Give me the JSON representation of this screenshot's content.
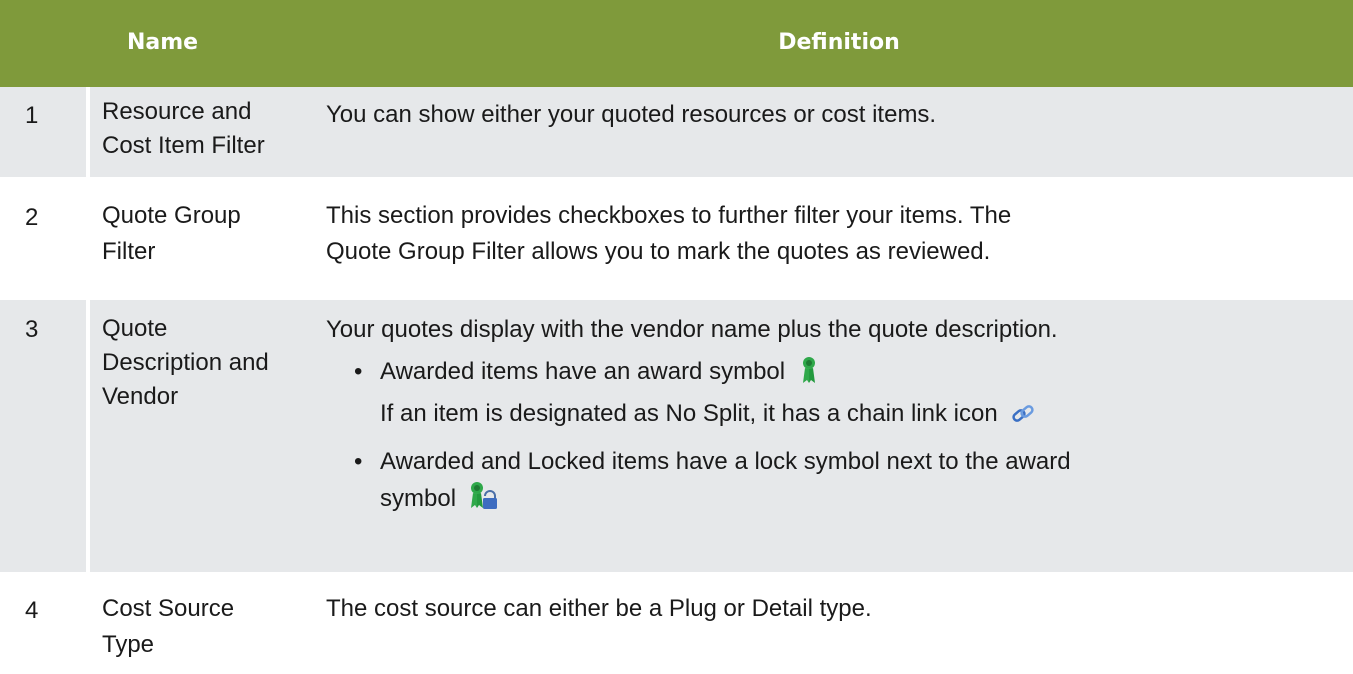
{
  "header": {
    "name": "Name",
    "definition": "Definition"
  },
  "rows": [
    {
      "number": "1",
      "name_line1": "Resource and",
      "name_line2": "Cost Item Filter",
      "definition": "You can show either your quoted resources or cost items."
    },
    {
      "number": "2",
      "name_line1": "Quote Group",
      "name_line2": "Filter",
      "def_line1": "This section provides checkboxes to further filter your items. The",
      "def_line2": "Quote Group Filter allows you to mark the quotes as reviewed."
    },
    {
      "number": "3",
      "name_line1": "Quote",
      "name_line2": "Description and",
      "name_line3": "Vendor",
      "definition": "Your quotes display with the vendor name plus the quote description.",
      "bullet1_line1": "Awarded items have an award symbol",
      "bullet1_line2": "If an item is designated as No Split, it has a chain link icon",
      "bullet2_line1": "Awarded and Locked items have a lock symbol next to the award",
      "bullet2_line2": "symbol",
      "icons": [
        "award-icon",
        "chain-link-icon",
        "award-lock-icon"
      ]
    },
    {
      "number": "4",
      "name_line1": "Cost Source",
      "name_line2": "Type",
      "definition": "The cost source can either be a Plug or Detail type."
    }
  ],
  "colors": {
    "header_bg": "#7f9a3b",
    "row_shade": "#e6e8ea"
  }
}
